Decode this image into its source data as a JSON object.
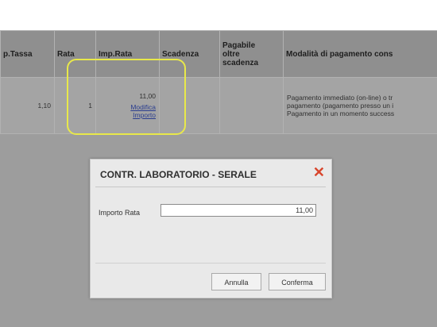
{
  "table": {
    "headers": {
      "imp_tassa": "p.Tassa",
      "rata": "Rata",
      "imp_rata": "Imp.Rata",
      "scadenza": "Scadenza",
      "pagabile": [
        "Pagabile",
        "oltre",
        "scadenza"
      ],
      "modalita": "Modalità di pagamento cons"
    },
    "row": {
      "imp_tassa": "1,10",
      "rata": "1",
      "imp_rata": "11,00",
      "modifica": [
        "Modifica",
        "Importo"
      ],
      "modalita": [
        "Pagamento immediato (on-line) o tr",
        "pagamento (pagamento presso un i",
        "Pagamento in un momento success"
      ]
    }
  },
  "dialog": {
    "title": "CONTR. LABORATORIO - SERALE",
    "label": "Importo Rata",
    "value": "11,00",
    "cancel_label": "Annulla",
    "confirm_label": "Conferma"
  },
  "colors": {
    "highlight": "#e8e84a",
    "close_icon": "#d8452c",
    "link": "#2a3d8f"
  }
}
